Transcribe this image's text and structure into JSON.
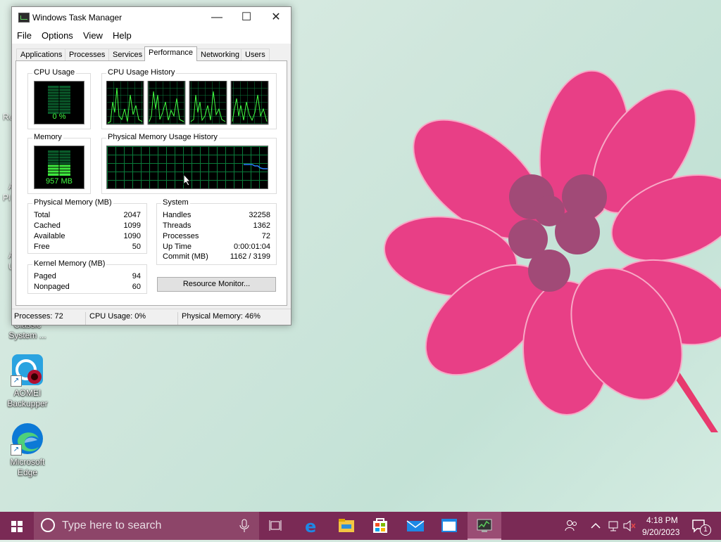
{
  "window": {
    "title": "Windows Task Manager",
    "controls": {
      "minimize": "—",
      "maximize": "☐",
      "close": "✕"
    }
  },
  "menu": [
    "File",
    "Options",
    "View",
    "Help"
  ],
  "tabs": [
    "Applications",
    "Processes",
    "Services",
    "Performance",
    "Networking",
    "Users"
  ],
  "active_tab": "Performance",
  "performance": {
    "cpu_usage_label": "CPU Usage",
    "cpu_usage_value": "0 %",
    "cpu_history_label": "CPU Usage History",
    "memory_label": "Memory",
    "memory_value": "957 MB",
    "memory_history_label": "Physical Memory Usage History",
    "physical_memory": {
      "label": "Physical Memory (MB)",
      "rows": [
        {
          "k": "Total",
          "v": "2047"
        },
        {
          "k": "Cached",
          "v": "1099"
        },
        {
          "k": "Available",
          "v": "1090"
        },
        {
          "k": "Free",
          "v": "50"
        }
      ]
    },
    "kernel_memory": {
      "label": "Kernel Memory (MB)",
      "rows": [
        {
          "k": "Paged",
          "v": "94"
        },
        {
          "k": "Nonpaged",
          "v": "60"
        }
      ]
    },
    "system": {
      "label": "System",
      "rows": [
        {
          "k": "Handles",
          "v": "32258"
        },
        {
          "k": "Threads",
          "v": "1362"
        },
        {
          "k": "Processes",
          "v": "72"
        },
        {
          "k": "Up Time",
          "v": "0:00:01:04"
        },
        {
          "k": "Commit (MB)",
          "v": "1162 / 3199"
        }
      ]
    },
    "resource_monitor_button": "Resource Monitor..."
  },
  "statusbar": {
    "processes": "Processes: 72",
    "cpu": "CPU Usage: 0%",
    "memory": "Physical Memory: 46%"
  },
  "desktop_icons": [
    {
      "label": "Classic System ...",
      "icon": "classic-system-icon"
    },
    {
      "label": "AOMEI Backupper",
      "icon": "aomei-backupper-icon"
    },
    {
      "label": "Microsoft Edge",
      "icon": "edge-icon"
    }
  ],
  "desktop_partial": [
    "Re",
    "A",
    "Pl",
    "A",
    "U"
  ],
  "taskbar": {
    "search_placeholder": "Type here to search",
    "time": "4:18 PM",
    "date": "9/20/2023",
    "notification_count": "1"
  },
  "colors": {
    "taskbar": "#7a2a55",
    "graph_green": "#42ff42",
    "graph_grid": "#0a7a3a",
    "memory_line": "#2a7fff"
  }
}
